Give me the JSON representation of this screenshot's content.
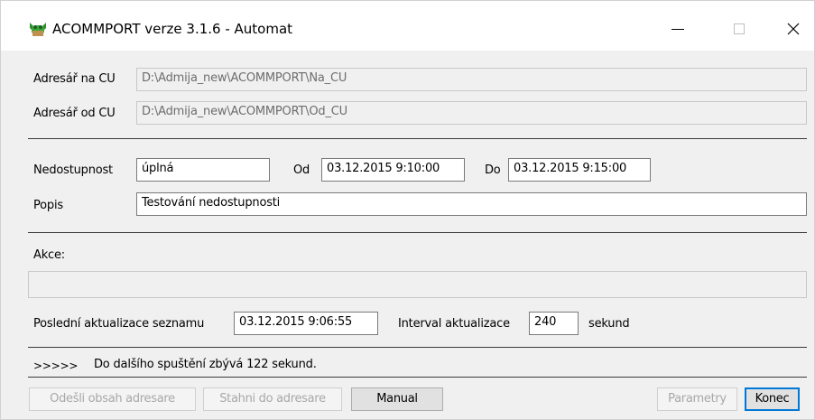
{
  "window": {
    "title": "ACOMMPORT verze 3.1.6 - Automat",
    "icon": "frog-app-icon",
    "controls": {
      "minimize": "—",
      "maximize": "☐",
      "close": "✕"
    }
  },
  "directories": {
    "to_cu_label": "Adresář na CU",
    "to_cu_value": "D:\\Admija_new\\ACOMMPORT\\Na_CU",
    "from_cu_label": "Adresář od CU",
    "from_cu_value": "D:\\Admija_new\\ACOMMPORT\\Od_CU"
  },
  "outage": {
    "unavailability_label": "Nedostupnost",
    "unavailability_value": "úplná",
    "from_label": "Od",
    "from_value": "03.12.2015 9:10:00",
    "to_label": "Do",
    "to_value": "03.12.2015 9:15:00",
    "description_label": "Popis",
    "description_value": "Testování nedostupnosti"
  },
  "action": {
    "label": "Akce:",
    "value": ""
  },
  "update": {
    "last_update_label": "Poslední aktualizace seznamu",
    "last_update_value": "03.12.2015 9:06:55",
    "interval_label": "Interval aktualizace",
    "interval_value": "240",
    "interval_unit": "sekund"
  },
  "status": {
    "arrows": ">>>>>",
    "message": "Do dalšího spuštění zbývá 122 sekund."
  },
  "buttons": {
    "send": "Odešli obsah adresare",
    "download": "Stahni do adresare",
    "manual": "Manual",
    "parameters": "Parametry",
    "end": "Konec"
  },
  "colors": {
    "window_bg": "#f0f0f0",
    "default_button_border": "#0078d7",
    "disabled_text": "#a8a8a8"
  }
}
